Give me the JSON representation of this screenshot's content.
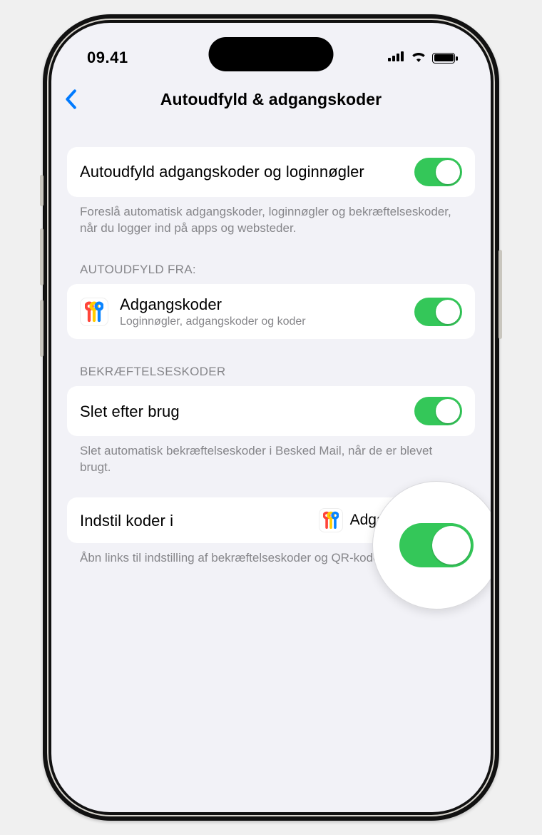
{
  "statusbar": {
    "time": "09.41"
  },
  "nav": {
    "title": "Autoudfyld & adgangskoder"
  },
  "section1": {
    "row_label": "Autoudfyld adgangskoder og loginnøgler",
    "footer": "Foreslå automatisk adgangskoder, loginnøgler og bekræftelseskoder, når du logger ind på apps og websteder."
  },
  "section2": {
    "header": "AUTOUDFYLD FRA:",
    "row_label": "Adgangskoder",
    "row_sub": "Loginnøgler, adgangskoder og koder"
  },
  "section3": {
    "header": "BEKRÆFTELSESKODER",
    "row_label": "Slet efter brug",
    "footer": "Slet automatisk bekræftelseskoder i Besked Mail, når de er blevet brugt."
  },
  "section4": {
    "row_label": "Indstil koder i",
    "value": "Adgangskoder",
    "footer": "Åbn links til indstilling af bekræftelseskoder og QR-koder i denne app."
  }
}
